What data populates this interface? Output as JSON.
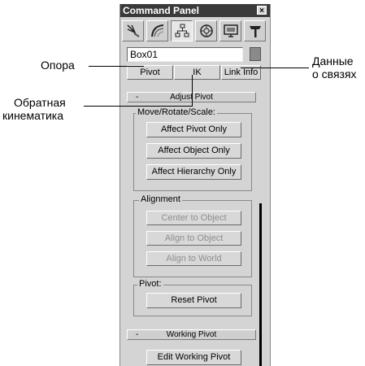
{
  "panel": {
    "title": "Command Panel",
    "close_label": "×",
    "tabs": [
      {
        "icon": "create-icon"
      },
      {
        "icon": "modify-icon"
      },
      {
        "icon": "hierarchy-icon"
      },
      {
        "icon": "motion-icon"
      },
      {
        "icon": "display-icon"
      },
      {
        "icon": "utilities-icon"
      }
    ],
    "object_name": "Box01",
    "object_color": "#8a8a8a",
    "mode_buttons": {
      "pivot": "Pivot",
      "ik": "IK",
      "link_info": "Link Info"
    },
    "adjust_pivot": {
      "toggle": "-",
      "title": "Adjust Pivot",
      "move_group": {
        "title": "Move/Rotate/Scale:",
        "buttons": [
          "Affect Pivot Only",
          "Affect Object Only",
          "Affect Hierarchy Only"
        ]
      },
      "alignment_group": {
        "title": "Alignment",
        "buttons": [
          "Center to Object",
          "Align to Object",
          "Align to World"
        ]
      },
      "pivot_group": {
        "title": "Pivot:",
        "button": "Reset Pivot"
      }
    },
    "working_pivot": {
      "toggle": "-",
      "title": "Working Pivot",
      "partial_button": "Edit Working Pivot"
    }
  },
  "annotations": {
    "pivot": "Опора",
    "ik_line1": "Обратная",
    "ik_line2": "кинематика",
    "link_line1": "Данные",
    "link_line2": "о связях"
  }
}
